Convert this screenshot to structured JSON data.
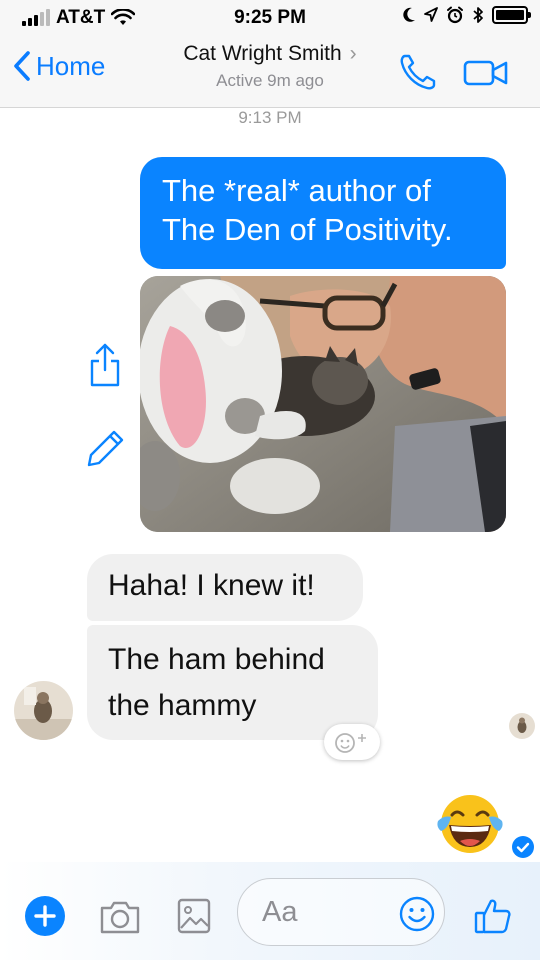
{
  "status_bar": {
    "carrier": "AT&T",
    "time": "9:25 PM",
    "signal_bars_filled": 3,
    "signal_bars_total": 5,
    "battery_level": 1.0
  },
  "nav": {
    "back_label": "Home",
    "contact_name": "Cat Wright Smith",
    "contact_status": "Active 9m ago"
  },
  "chat": {
    "timestamp": "9:13 PM",
    "outgoing_message": {
      "line1": "The *real* author of",
      "line2": "The Den of Positivity."
    },
    "incoming_message_1": "Haha! I knew it!",
    "incoming_message_2": {
      "line1": "The ham behind",
      "line2": "the hammy"
    },
    "emoji_reply": "tears-of-joy"
  },
  "composer": {
    "placeholder": "Aa"
  },
  "colors": {
    "accent": "#0a84ff",
    "incoming_bubble": "#f0f0f0",
    "bar_bg": "#f7f7f7"
  }
}
